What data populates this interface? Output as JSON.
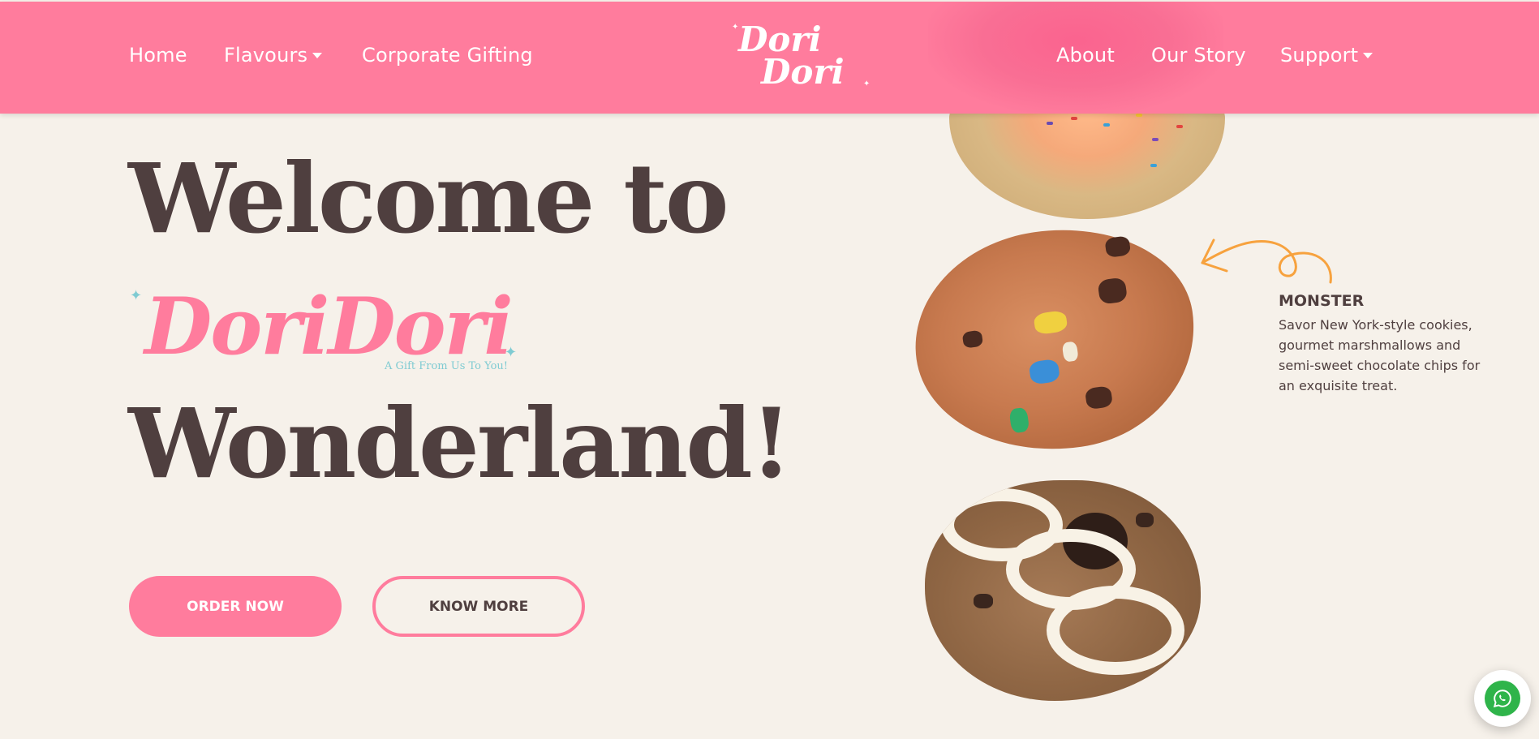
{
  "nav": {
    "home": "Home",
    "flavours": "Flavours",
    "corporate": "Corporate Gifting",
    "about": "About",
    "story": "Our Story",
    "support": "Support",
    "logo_line1": "Dori",
    "logo_line2": "Dori"
  },
  "hero": {
    "line1": "Welcome to",
    "brand": "DoriDori",
    "brand_tagline": "A Gift From Us To You!",
    "line3": "Wonderland!",
    "order_button": "ORDER NOW",
    "know_button": "KNOW MORE"
  },
  "feature": {
    "title": "MONSTER",
    "description": "Savor New York-style cookies, gourmet marshmallows and semi-sweet chocolate chips for an exquisite treat."
  },
  "colors": {
    "nav_bg": "#ff7c9d",
    "page_bg": "#f6f1ea",
    "text_dark": "#4f3f3f",
    "accent_pink": "#ff7c9d",
    "accent_teal": "#7fcbd2",
    "arrow_orange": "#f7a23e",
    "whatsapp_green": "#2fb44a"
  },
  "icons": {
    "dropdown": "caret-down-icon",
    "whatsapp": "whatsapp-icon",
    "arrow": "curly-arrow-icon"
  }
}
